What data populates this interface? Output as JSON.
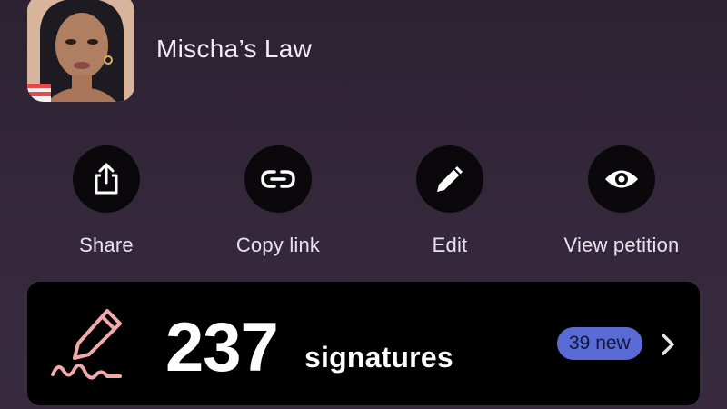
{
  "header": {
    "petition_title": "Mischa’s Law",
    "avatar_icon": "profile-portrait"
  },
  "actions": [
    {
      "label": "Share",
      "icon": "share-icon"
    },
    {
      "label": "Copy link",
      "icon": "link-icon"
    },
    {
      "label": "Edit",
      "icon": "pencil-icon"
    },
    {
      "label": "View petition",
      "icon": "eye-icon"
    }
  ],
  "signatures": {
    "count": "237",
    "label": "signatures",
    "new_badge": "39 new",
    "icon": "signature-pen-icon"
  },
  "colors": {
    "background": "#2c2231",
    "card": "#000000",
    "badge": "#5a6bd6",
    "accent_icon": "#f2a9a9"
  }
}
